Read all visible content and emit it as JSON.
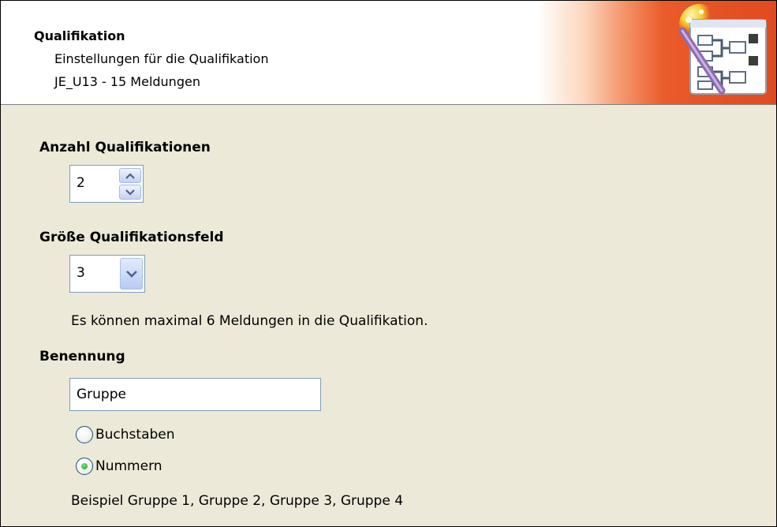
{
  "header": {
    "title": "Qualifikation",
    "subtitle": "Einstellungen für die Qualifikation",
    "event_info": "JE_U13 - 15 Meldungen",
    "icon": "wizard-icon"
  },
  "qualifications": {
    "label": "Anzahl Qualifikationen",
    "value": "2"
  },
  "field_size": {
    "label": "Größe Qualifikationsfeld",
    "value": "3",
    "info": "Es können maximal 6 Meldungen in die Qualifikation."
  },
  "naming": {
    "label": "Benennung",
    "value": "Gruppe",
    "options": [
      {
        "label": "Buchstaben",
        "selected": false
      },
      {
        "label": "Nummern",
        "selected": true
      }
    ],
    "example": "Beispiel Gruppe 1, Gruppe 2, Gruppe 3, Gruppe 4"
  },
  "colors": {
    "dialog_bg": "#ece9d8",
    "header_accent": "#e04a1f",
    "field_border": "#7f9db9",
    "radio_selected": "#21a121"
  }
}
